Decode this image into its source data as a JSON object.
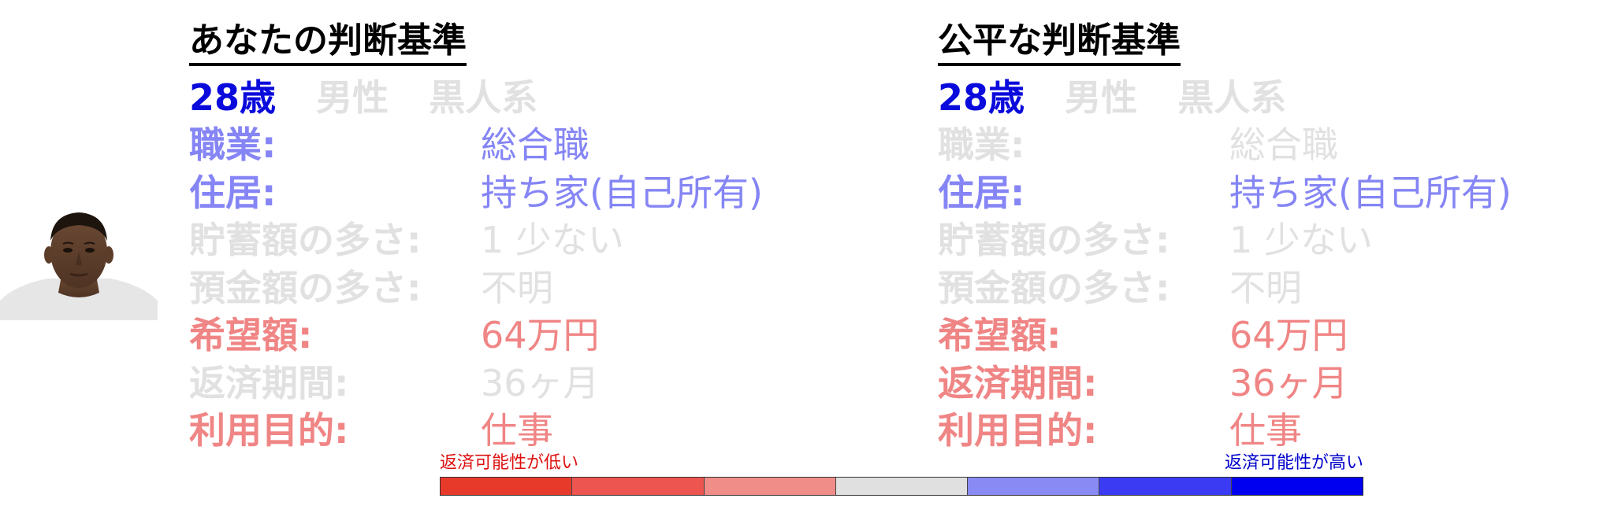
{
  "left_panel": {
    "title": "あなたの判断基準",
    "demographics": {
      "age": "28歳",
      "gender": "男性",
      "ethnicity": "黒人系"
    },
    "attributes": [
      {
        "label": "職業:",
        "value": "総合職",
        "state": "blue"
      },
      {
        "label": "住居:",
        "value": "持ち家(自己所有)",
        "state": "blue"
      },
      {
        "label": "貯蓄額の多さ:",
        "value": "1 少ない",
        "state": "gray"
      },
      {
        "label": "預金額の多さ:",
        "value": "不明",
        "state": "gray"
      },
      {
        "label": "希望額:",
        "value": "64万円",
        "state": "red"
      },
      {
        "label": "返済期間:",
        "value": "36ヶ月",
        "state": "gray"
      },
      {
        "label": "利用目的:",
        "value": "仕事",
        "state": "red"
      }
    ]
  },
  "right_panel": {
    "title": "公平な判断基準",
    "demographics": {
      "age": "28歳",
      "gender": "男性",
      "ethnicity": "黒人系"
    },
    "attributes": [
      {
        "label": "職業:",
        "value": "総合職",
        "state": "gray"
      },
      {
        "label": "住居:",
        "value": "持ち家(自己所有)",
        "state": "blue"
      },
      {
        "label": "貯蓄額の多さ:",
        "value": "1 少ない",
        "state": "gray"
      },
      {
        "label": "預金額の多さ:",
        "value": "不明",
        "state": "gray"
      },
      {
        "label": "希望額:",
        "value": "64万円",
        "state": "red"
      },
      {
        "label": "返済期間:",
        "value": "36ヶ月",
        "state": "red"
      },
      {
        "label": "利用目的:",
        "value": "仕事",
        "state": "red"
      }
    ]
  },
  "colors": {
    "blue": "#8585f5",
    "gray": "#e1e1e1",
    "red": "#f08585",
    "age": "#0a0adc",
    "demographics_dim": "#e1e1e1"
  },
  "color_scale": {
    "low_label": "返済可能性が低い",
    "high_label": "返済可能性が高い",
    "segments": [
      "#e83a2a",
      "#ec5550",
      "#f08d88",
      "#e0e0e0",
      "#8a8af5",
      "#3b3bf3",
      "#0000f0"
    ]
  },
  "avatar": {
    "icon": "person-photo"
  }
}
